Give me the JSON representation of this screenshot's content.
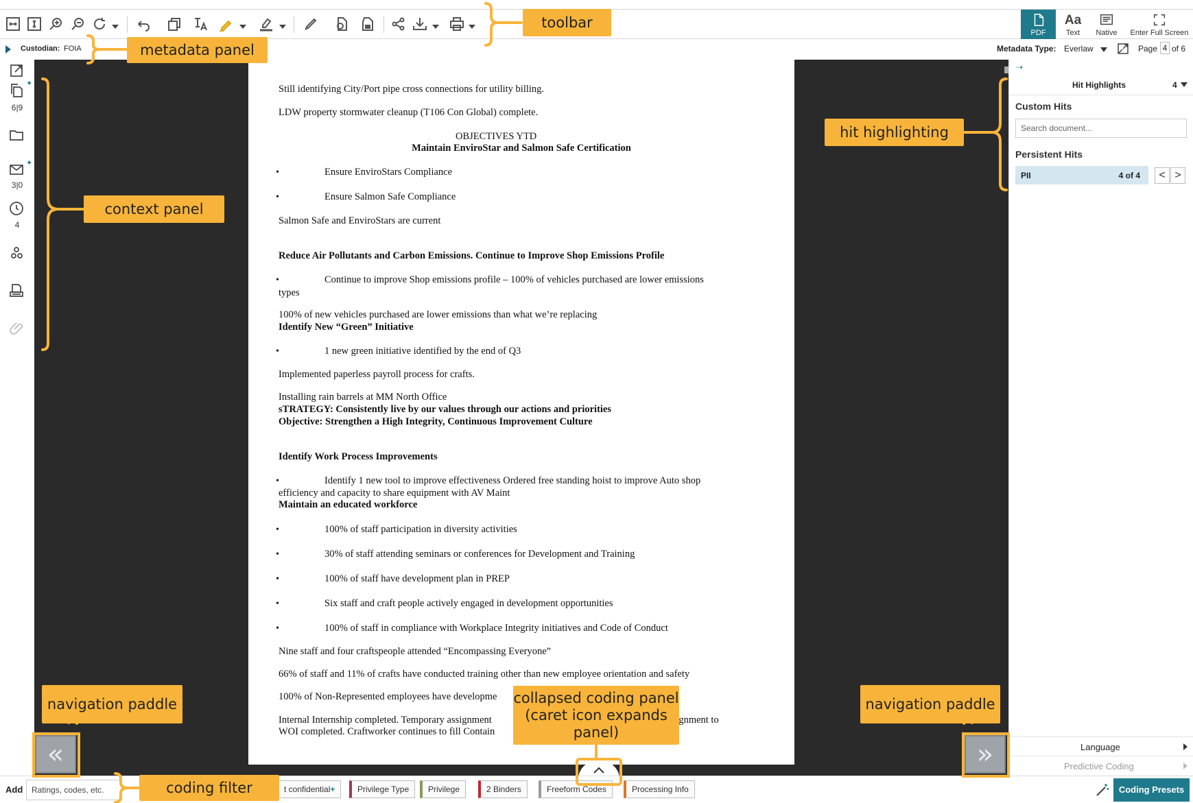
{
  "toolbar": {
    "tools": [
      {
        "icon": "fit-width-icon"
      },
      {
        "icon": "fit-height-icon"
      },
      {
        "icon": "zoom-in-icon"
      },
      {
        "icon": "zoom-out-icon"
      },
      {
        "icon": "rotate-icon"
      },
      {
        "icon": "undo-icon"
      },
      {
        "icon": "copy-icon"
      },
      {
        "icon": "text-select-icon"
      },
      {
        "icon": "highlighter-icon"
      },
      {
        "icon": "redact-icon"
      },
      {
        "icon": "pen-icon"
      },
      {
        "icon": "stamp-icon"
      },
      {
        "icon": "redact-stamp-icon"
      },
      {
        "icon": "share-icon"
      },
      {
        "icon": "download-icon"
      },
      {
        "icon": "print-icon"
      }
    ],
    "views": {
      "pdf": "PDF",
      "text": "Text",
      "text_glyph": "Aa",
      "native": "Native",
      "fullscreen": "Enter Full Screen"
    }
  },
  "metadata": {
    "custodian_label": "Custodian:",
    "custodian_value": "FOIA",
    "type_label": "Metadata Type:",
    "type_value": "Everlaw",
    "page_label": "Page",
    "page_current": "4",
    "page_of": "of 6"
  },
  "context": {
    "items": [
      {
        "icon": "expand-icon",
        "count": ""
      },
      {
        "icon": "versions-icon",
        "count": "6|9"
      },
      {
        "icon": "folder-icon",
        "count": ""
      },
      {
        "icon": "email-icon",
        "count": "3|0"
      },
      {
        "icon": "history-icon",
        "count": "4"
      },
      {
        "icon": "people-icon",
        "count": ""
      },
      {
        "icon": "production-icon",
        "count": ""
      },
      {
        "icon": "attachment-icon",
        "count": ""
      }
    ]
  },
  "document": {
    "lines": [
      {
        "text": "Still identifying City/Port pipe cross connections for utility billing."
      },
      {
        "text": "LDW property stormwater cleanup (T106 Con Global) complete."
      },
      {
        "text": "OBJECTIVES          YTD"
      },
      {
        "text": "Maintain EnviroStar and Salmon Safe Certification"
      },
      {
        "text": "Ensure EnviroStars Compliance"
      },
      {
        "text": "Ensure Salmon Safe Compliance"
      },
      {
        "text": "Salmon Safe and EnviroStars are current"
      },
      {
        "text": "Reduce Air Pollutants and Carbon Emissions.  Continue to Improve Shop Emissions Profile"
      },
      {
        "text": "Continue to improve Shop emissions profile – 100% of vehicles purchased are lower emissions"
      },
      {
        "text": "types"
      },
      {
        "text": "100% of new vehicles purchased are lower emissions than what we’re replacing"
      },
      {
        "text": "Identify New “Green” Initiative"
      },
      {
        "text": "1 new green initiative identified by the end of Q3"
      },
      {
        "text": "Implemented paperless payroll process for crafts."
      },
      {
        "text": "Installing rain barrels at MM North Office"
      },
      {
        "text": "sTRATEGY:  Consistently live by our values through our actions and priorities"
      },
      {
        "text": "Objective:  Strengthen a High Integrity, Continuous Improvement Culture"
      },
      {
        "text": "Identify Work Process Improvements"
      },
      {
        "text": "Identify 1 new tool to improve effectiveness    Ordered free standing hoist to improve Auto shop"
      },
      {
        "text": "efficiency and capacity to share equipment with AV Maint"
      },
      {
        "text": "Maintain an educated workforce"
      },
      {
        "text": "100% of staff participation in diversity activities"
      },
      {
        "text": "30% of staff attending seminars or conferences for Development and Training"
      },
      {
        "text": "100% of staff have development plan in PREP"
      },
      {
        "text": "Six staff and craft people actively engaged in development opportunities"
      },
      {
        "text": "100% of staff in compliance with Workplace Integrity initiatives and Code of Conduct"
      },
      {
        "text": "Nine staff and four craftspeople attended “Encompassing Everyone”"
      },
      {
        "text": "66% of staff and 11% of crafts have conducted training other than new employee orientation and safety"
      },
      {
        "text": "100% of Non-Represented employees have developme"
      },
      {
        "text": "Internal Internship completed.  Temporary assignment"
      },
      {
        "text": "ssignment to"
      },
      {
        "text": "WOI completed.  Craftworker continues to fill Contain"
      }
    ],
    "bullet": "•"
  },
  "navigation": {
    "prev_glyph": "«",
    "next_glyph": "»"
  },
  "hits": {
    "title": "Hit Highlights",
    "count": "4",
    "custom_label": "Custom Hits",
    "search_placeholder": "Search document...",
    "persistent_label": "Persistent Hits",
    "pii_name": "PII",
    "pii_count": "4 of 4",
    "prev": "<",
    "next": ">",
    "language": "Language",
    "predictive": "Predictive Coding"
  },
  "coding": {
    "add_label": "Add",
    "filter_placeholder": "Ratings, codes, etc.",
    "chips": [
      {
        "label": "t confidential",
        "plus": "+",
        "color": "#7a4a8a"
      },
      {
        "label": "Privilege Type",
        "plus": "",
        "color": "#9a3a5a"
      },
      {
        "label": "Privilege",
        "plus": "",
        "color": "#8a9a5a"
      },
      {
        "label": "2 Binders",
        "plus": "",
        "color": "#c0282d"
      },
      {
        "label": "Freeform Codes",
        "plus": "",
        "color": "#9a9a9a"
      },
      {
        "label": "Processing Info",
        "plus": "",
        "color": "#d9772a"
      }
    ],
    "presets_label": "Coding Presets"
  },
  "annotations": {
    "toolbar": "toolbar",
    "metadata_panel": "metadata panel",
    "context_panel": "context panel",
    "hit_highlighting": "hit highlighting",
    "nav_left": "navigation paddle",
    "nav_right": "navigation paddle",
    "collapsed_coding": "collapsed coding panel (caret icon expands panel)",
    "coding_filter": "coding filter"
  },
  "colors": {
    "accent": "#1f7a8c",
    "callout": "#f8b43a",
    "viewer_bg": "#2a2a2a",
    "pii_bg": "#d4e6ef"
  }
}
